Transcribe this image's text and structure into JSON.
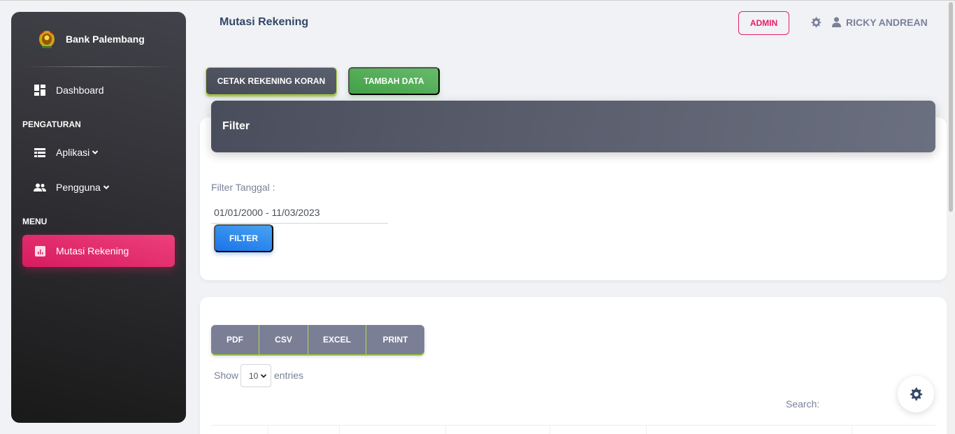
{
  "sidebar": {
    "brand": "Bank Palembang",
    "items": {
      "dashboard": "Dashboard",
      "pengaturan": "PENGATURAN",
      "aplikasi": "Aplikasi",
      "pengguna": "Pengguna",
      "menu": "MENU",
      "mutasi": "Mutasi Rekening"
    }
  },
  "header": {
    "title": "Mutasi Rekening",
    "role": "ADMIN",
    "user": "RICKY ANDREAN"
  },
  "actions": {
    "cetak": "CETAK REKENING KORAN",
    "tambah": "TAMBAH DATA"
  },
  "filter": {
    "title": "Filter",
    "label": "Filter Tanggal :",
    "date_range": "01/01/2000 - 11/03/2023",
    "button": "FILTER"
  },
  "table": {
    "exports": [
      "PDF",
      "CSV",
      "EXCEL",
      "PRINT"
    ],
    "show": "Show",
    "entries_value": "10",
    "entries": "entries",
    "search": "Search:"
  },
  "colors": {
    "accent": "#e91e63",
    "success": "#4caf50",
    "info": "#1a73e8",
    "dark": "#42424a"
  }
}
